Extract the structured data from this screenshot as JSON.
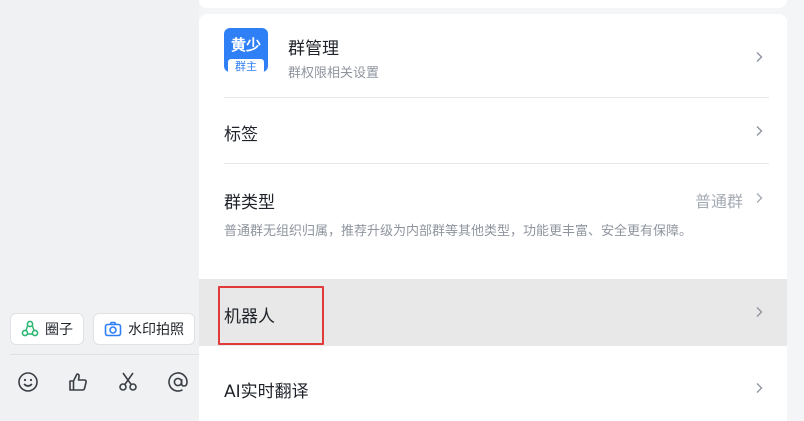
{
  "quick_actions": [
    {
      "label": "圈子",
      "icon": "circle-group-icon"
    },
    {
      "label": "水印拍照",
      "icon": "camera-icon"
    }
  ],
  "toolbar_icons": [
    "emoji-icon",
    "thumbs-up-icon",
    "scissors-icon",
    "at-icon"
  ],
  "settings": {
    "group_manage": {
      "avatar_name": "黄少",
      "avatar_badge": "群主",
      "title": "群管理",
      "subtitle": "群权限相关设置"
    },
    "tags": {
      "title": "标签"
    },
    "group_type": {
      "title": "群类型",
      "value": "普通群",
      "description": "普通群无组织归属，推荐升级为内部群等其他类型，功能更丰富、安全更有保障。"
    },
    "robot": {
      "title": "机器人"
    },
    "ai_translate": {
      "title": "AI实时翻译"
    }
  },
  "colors": {
    "accent": "#2f7ff7",
    "highlight_border": "#e03a3a",
    "hover_row": "#e8e8e8"
  }
}
